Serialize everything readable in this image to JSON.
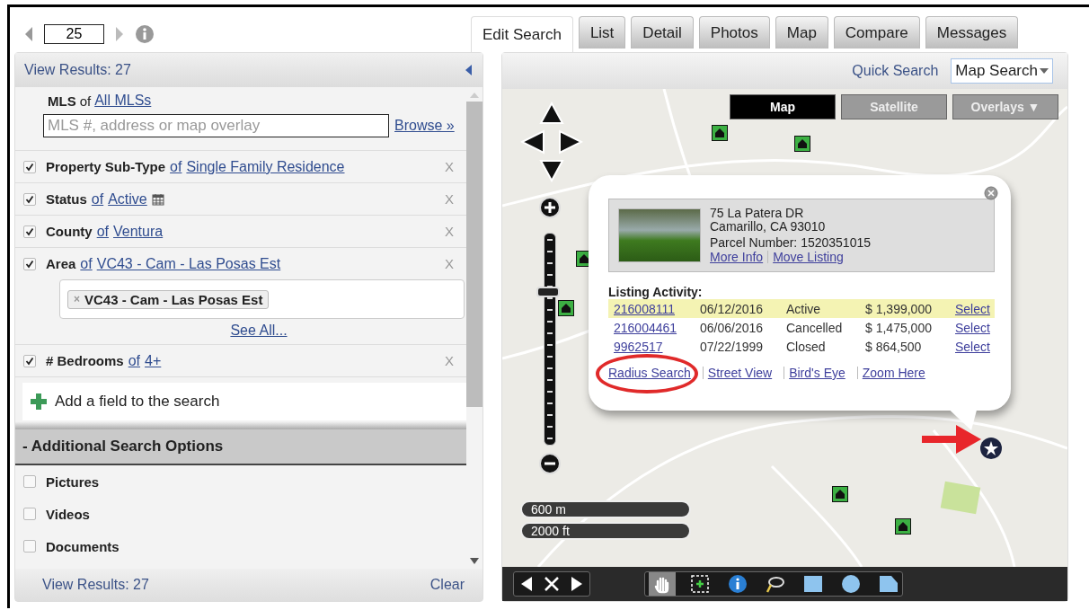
{
  "pager": {
    "value": "25"
  },
  "tabs": [
    {
      "label": "Edit Search",
      "selected": true
    },
    {
      "label": "List",
      "selected": false
    },
    {
      "label": "Detail",
      "selected": false
    },
    {
      "label": "Photos",
      "selected": false
    },
    {
      "label": "Map",
      "selected": false
    },
    {
      "label": "Compare",
      "selected": false
    },
    {
      "label": "Messages",
      "selected": false
    }
  ],
  "search_panel": {
    "header": "View Results: 27",
    "mls": {
      "label": "MLS",
      "of": "of",
      "value": "All MLSs",
      "placeholder": "MLS #, address or map overlay",
      "browse": "Browse »"
    },
    "criteria": [
      {
        "kind": "plain",
        "label": "Property Sub-Type",
        "of": "of",
        "value": "Single Family Residence",
        "checked": true,
        "remove": "X"
      },
      {
        "kind": "date",
        "label": "Status",
        "of": "of",
        "value": "Active",
        "checked": true,
        "remove": "X"
      },
      {
        "kind": "plain",
        "label": "County",
        "of": "of",
        "value": "Ventura",
        "checked": true,
        "remove": "X"
      },
      {
        "kind": "tags",
        "label": "Area",
        "of": "of",
        "value": "VC43 - Cam - Las Posas Est",
        "checked": true,
        "remove": "X",
        "tags": [
          {
            "remove": "×",
            "label": "VC43 - Cam - Las Posas Est"
          }
        ],
        "see_all": "See All..."
      },
      {
        "kind": "plain",
        "label": "# Bedrooms",
        "of": "of",
        "value": "4+",
        "checked": true,
        "remove": "X"
      }
    ],
    "add_field": "Add a field to the search",
    "options_header": "- Additional Search Options",
    "options": [
      {
        "label": "Pictures",
        "checked": false
      },
      {
        "label": "Videos",
        "checked": false
      },
      {
        "label": "Documents",
        "checked": false
      }
    ],
    "footer": {
      "results": "View Results: 27",
      "clear": "Clear"
    }
  },
  "map_panel": {
    "quick_search": "Quick Search",
    "mode": "Map Search",
    "map_types": [
      {
        "label": "Map",
        "selected": true
      },
      {
        "label": "Satellite",
        "selected": false
      }
    ],
    "overlays": "Overlays ▼",
    "zoom": {
      "level": 0.72
    },
    "scale": [
      "600 m",
      "2000 ft"
    ],
    "popup": {
      "address": "75 La Patera DR",
      "city": "Camarillo, CA 93010",
      "parcel": "Parcel Number: 1520351015",
      "links": [
        "More Info",
        "Move Listing"
      ],
      "activity_title": "Listing Activity:",
      "listings": [
        {
          "mls": "216008111",
          "date": "06/12/2016",
          "status": "Active",
          "price": "$ 1,399,000",
          "action": "Select",
          "selected": true
        },
        {
          "mls": "216004461",
          "date": "06/06/2016",
          "status": "Cancelled",
          "price": "$ 1,475,000",
          "action": "Select",
          "selected": false
        },
        {
          "mls": "9962517",
          "date": "07/22/1999",
          "status": "Closed",
          "price": "$ 864,500",
          "action": "Select",
          "selected": false
        }
      ],
      "actions": [
        {
          "label": "Radius Search",
          "circled": true
        },
        {
          "label": "Street View",
          "circled": false
        },
        {
          "label": "Bird's Eye",
          "circled": false
        },
        {
          "label": "Zoom Here",
          "circled": false
        }
      ]
    }
  }
}
